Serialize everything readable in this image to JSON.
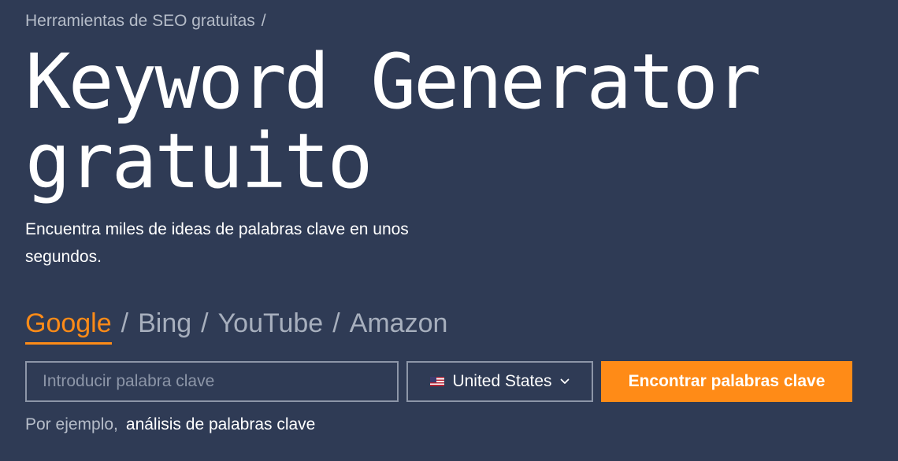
{
  "breadcrumb": {
    "link": "Herramientas de SEO gratuitas",
    "separator": "/"
  },
  "title": {
    "line1": "Keyword Generator",
    "line2": "gratuito"
  },
  "subtitle": "Encuentra miles de ideas de palabras clave en unos segundos.",
  "engines": {
    "items": [
      {
        "label": "Google",
        "active": true
      },
      {
        "label": "Bing",
        "active": false
      },
      {
        "label": "YouTube",
        "active": false
      },
      {
        "label": "Amazon",
        "active": false
      }
    ],
    "separator": "/"
  },
  "search": {
    "placeholder": "Introducir palabra clave",
    "value": ""
  },
  "country": {
    "label": "United States",
    "flag_icon": "us-flag-icon"
  },
  "submit_label": "Encontrar palabras clave",
  "example": {
    "prefix": "Por ejemplo,",
    "link": "análisis de palabras clave"
  },
  "colors": {
    "background": "#2f3b55",
    "accent": "#ff8b17",
    "muted_text": "#b6bdc9",
    "border": "#8d96a8"
  }
}
